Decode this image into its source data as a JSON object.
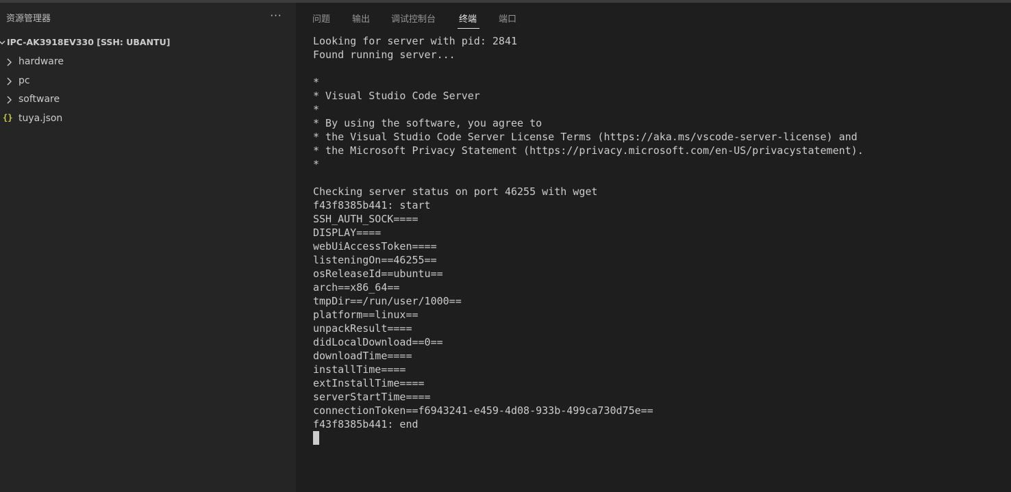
{
  "sidebar": {
    "title": "资源管理器",
    "more_label": "···",
    "root": {
      "label": "IPC-AK3918EV330 [SSH: UBANTU]"
    },
    "items": [
      {
        "label": "hardware",
        "type": "folder"
      },
      {
        "label": "pc",
        "type": "folder"
      },
      {
        "label": "software",
        "type": "folder"
      },
      {
        "label": "tuya.json",
        "type": "json-file",
        "icon": "{}"
      }
    ]
  },
  "panel": {
    "tabs": [
      {
        "label": "问题"
      },
      {
        "label": "输出"
      },
      {
        "label": "调试控制台"
      },
      {
        "label": "终端",
        "active": true
      },
      {
        "label": "端口"
      }
    ]
  },
  "terminal": {
    "lines": [
      "Looking for server with pid: 2841",
      "Found running server...",
      "",
      "*",
      "* Visual Studio Code Server",
      "*",
      "* By using the software, you agree to",
      "* the Visual Studio Code Server License Terms (https://aka.ms/vscode-server-license) and",
      "* the Microsoft Privacy Statement (https://privacy.microsoft.com/en-US/privacystatement).",
      "*",
      "",
      "Checking server status on port 46255 with wget",
      "f43f8385b441: start",
      "SSH_AUTH_SOCK====",
      "DISPLAY====",
      "webUiAccessToken====",
      "listeningOn==46255==",
      "osReleaseId==ubuntu==",
      "arch==x86_64==",
      "tmpDir==/run/user/1000==",
      "platform==linux==",
      "unpackResult====",
      "didLocalDownload==0==",
      "downloadTime====",
      "installTime====",
      "extInstallTime====",
      "serverStartTime====",
      "connectionToken==f6943241-e459-4d08-933b-499ca730d75e==",
      "f43f8385b441: end"
    ]
  },
  "colors": {
    "sidebar_bg": "#252526",
    "panel_bg": "#1e1e1e",
    "text": "#cccccc",
    "json_icon": "#cbcb41"
  }
}
